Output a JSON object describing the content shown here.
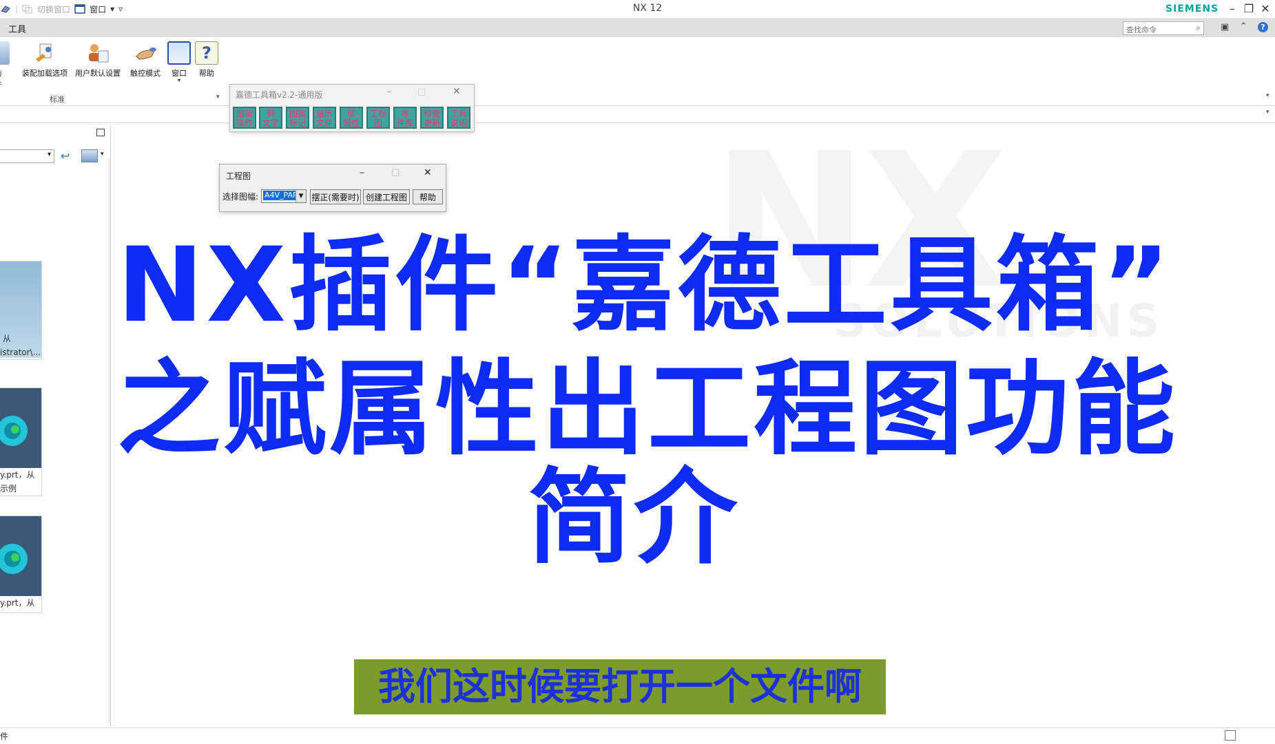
{
  "window": {
    "title": "NX 12",
    "brand": "SIEMENS",
    "quick_access": {
      "switch_window": "切换窗口",
      "window_menu": "窗口"
    }
  },
  "menubar": {
    "tools": "工具",
    "search_placeholder": "查找命令"
  },
  "ribbon": {
    "buttons": [
      {
        "label": "访\n件",
        "icon": "recent-files-icon"
      },
      {
        "label": "装配加载选项",
        "icon": "assembly-load-options-icon"
      },
      {
        "label": "用户默认设置",
        "icon": "user-defaults-icon"
      },
      {
        "label": "触控模式",
        "icon": "touch-mode-icon"
      },
      {
        "label": "窗口",
        "icon": "window-icon"
      },
      {
        "label": "帮助",
        "icon": "help-icon"
      }
    ],
    "group_label": "标准"
  },
  "left_panel": {
    "items": [
      {
        "caption_1": "从",
        "caption_2": "istrator\\..."
      },
      {
        "caption_1": "y.prt，从",
        "caption_2": "示例"
      },
      {
        "caption_1": "y.prt，从",
        "caption_2": ""
      }
    ]
  },
  "toolbox": {
    "title": "嘉德工具箱v2.2-通用版",
    "buttons": [
      {
        "l1": "图层",
        "l2": "操作"
      },
      {
        "l1": "刻",
        "l2": "文字"
      },
      {
        "l1": "图案",
        "l2": "标记"
      },
      {
        "l1": "遍历",
        "l2": "文件"
      },
      {
        "l1": "赋",
        "l2": "属性"
      },
      {
        "l1": "工程",
        "l2": "图"
      },
      {
        "l1": "零",
        "l2": "件库"
      },
      {
        "l1": "检查",
        "l2": "更新"
      },
      {
        "l1": "工具",
        "l2": "说明"
      }
    ]
  },
  "drawing_dialog": {
    "title": "工程图",
    "select_label": "选择图幅:",
    "select_value": "A4V_PAR",
    "buttons": [
      "摆正(需要时)",
      "创建工程图",
      "帮助"
    ]
  },
  "overlay": {
    "line1": "NX插件“嘉德工具箱”",
    "line2": "之赋属性出工程图功能",
    "line3": "简介",
    "subtitle": "我们这时候要打开一个文件啊"
  },
  "statusbar": {
    "text": "件"
  },
  "colors": {
    "headline": "#0d2bf2",
    "subtitle_bg": "#7d9b2a",
    "toolbox_button": "#41a39e",
    "brand": "#0aa1a1"
  }
}
